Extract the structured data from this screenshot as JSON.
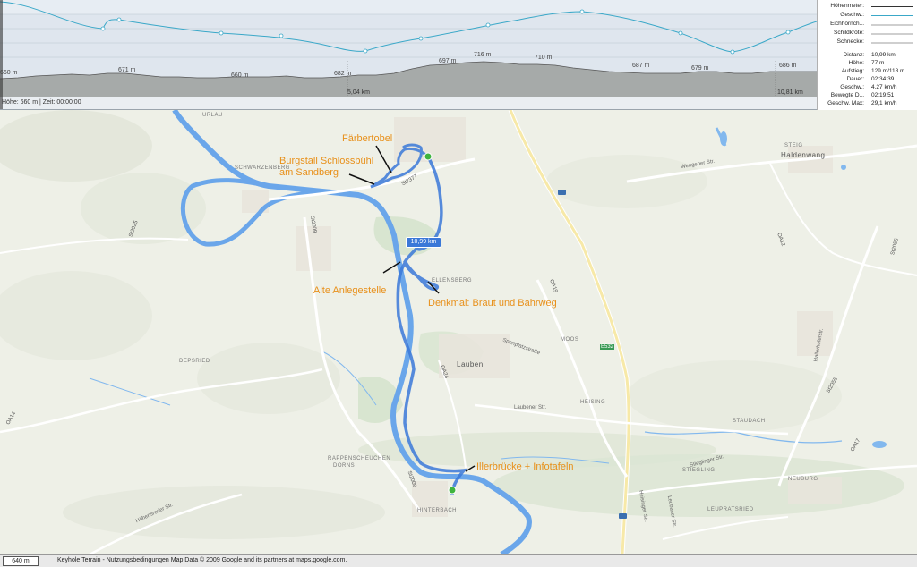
{
  "profile": {
    "altitudes": [
      "660 m",
      "671 m",
      "660 m",
      "682 m",
      "697 m",
      "716 m",
      "710 m",
      "687 m",
      "679 m",
      "686 m"
    ],
    "distances": [
      "5,04 km",
      "10,81 km"
    ],
    "status": "Höhe: 660 m | Zeit: 00:00:00"
  },
  "legend": [
    {
      "label": "Höhenmeter:",
      "color": "#333333"
    },
    {
      "label": "Geschw.:",
      "color": "#3aa8c8"
    },
    {
      "label": "Eichhörnch...",
      "color": "#c8c8c8"
    },
    {
      "label": "Schildkröte:",
      "color": "#c8c8c8"
    },
    {
      "label": "Schnecke:",
      "color": "#c8c8c8"
    }
  ],
  "stats": [
    {
      "key": "Distanz:",
      "value": "10,99 km"
    },
    {
      "key": "Höhe:",
      "value": "77 m"
    },
    {
      "key": "Aufstieg:",
      "value": "129 m/118 m"
    },
    {
      "key": "Dauer:",
      "value": "02:34:39"
    },
    {
      "key": "Geschw.:",
      "value": "4,27 km/h"
    },
    {
      "key": "Bewegte D...",
      "value": "02:19:51"
    },
    {
      "key": "Geschw. Max:",
      "value": "29,1 km/h"
    }
  ],
  "map": {
    "route_length": "10,99 km",
    "annotations": {
      "faerbertobel": "Färbertobel",
      "burgstall_1": "Burgstall Schlossbühl",
      "burgstall_2": "am Sandberg",
      "anlegestelle": "Alte Anlegestelle",
      "denkmal": "Denkmal: Braut und Bahrweg",
      "illerbruecke": "Illerbrücke + Infotafeln"
    },
    "places": {
      "haldenwang": "Haldenwang",
      "lauben": "Lauben",
      "hinterbach": "HINTERBACH",
      "heising": "HEISING",
      "moos": "MOOS",
      "ellensberg": "ELLENSBERG",
      "schwarzenberg": "SCHWARZENBERG",
      "depsried": "DEPSRIED",
      "dorns": "DORNS",
      "rappenscheuchen": "RAPPENSCHEUCHEN",
      "stiegling": "STIEGLING",
      "neuburg": "NEUBURG",
      "leupratsried": "LEUPRATSRIED",
      "staudach": "STAUDACH",
      "steig": "STEIG",
      "urlau": "URLAU"
    },
    "streets": {
      "wengener": "Wengener Str.",
      "sportplatz": "Sportplatzstraße",
      "laubener": "Laubener Str.",
      "heisinger": "Heisinger Str.",
      "hoehensreder": "Höhensreder Str.",
      "hallerhof": "Hallerhoferstr.",
      "leubaser": "Leubaser Str.",
      "stiegl": "Stieglinger Str."
    },
    "road_numbers": {
      "st2009a": "St2009",
      "st2009b": "St2009",
      "st2377": "St2377",
      "st2055a": "St2055",
      "st2055b": "St2055",
      "oa14": "OA14",
      "oa19": "OA19",
      "oa12": "OA12",
      "oa24": "OA24",
      "oa17": "OA17",
      "e532": "E532",
      "st2025": "St2025"
    }
  },
  "footer": {
    "scale": "640 m",
    "credit_prefix": "Keyhole Terrain - ",
    "credit_link": "Nutzungsbedingungen",
    "credit_suffix": " Map Data © 2009 Google and its partners at maps.google.com."
  }
}
